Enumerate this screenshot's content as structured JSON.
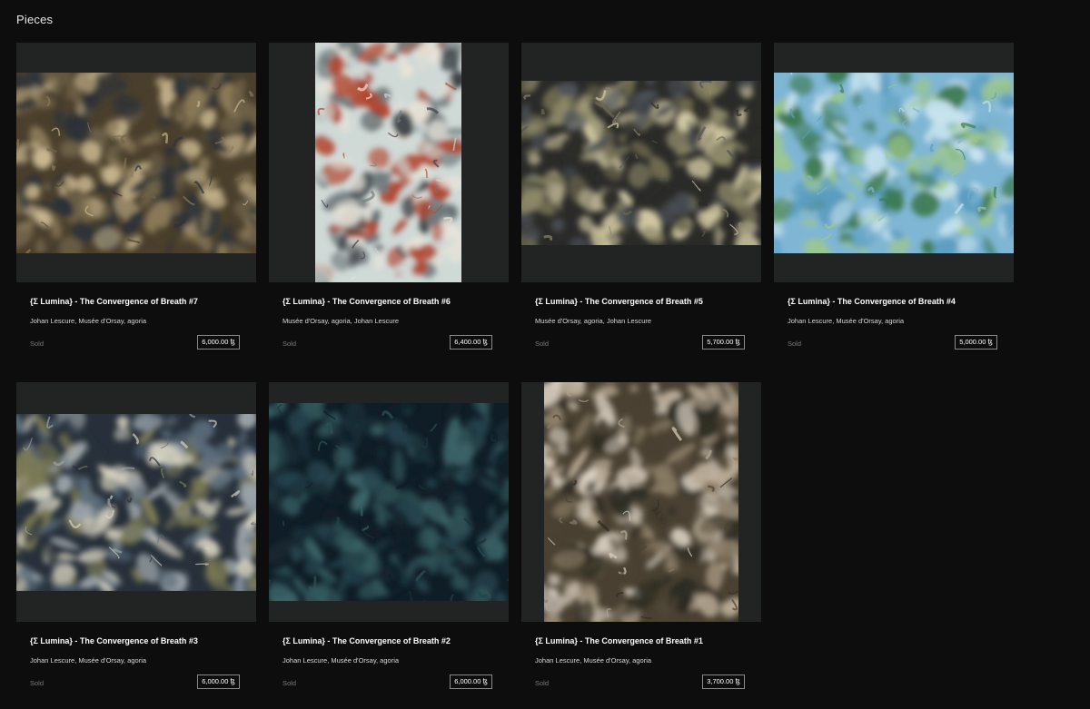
{
  "section": {
    "title": "Pieces"
  },
  "pieces": [
    {
      "title": "{Σ Lumina} - The Convergence of Breath #7",
      "artists": "Johan Lescure, Musée d'Orsay, agoria",
      "status": "Sold",
      "price": "6,000.00 ꜩ",
      "palette": [
        "#4a3f2c",
        "#8a7a58",
        "#c9b78f",
        "#2b3138",
        "#6e6248"
      ]
    },
    {
      "title": "{Σ Lumina} - The Convergence of Breath #6",
      "artists": "Musée d'Orsay, agoria, Johan Lescure",
      "status": "Sold",
      "price": "6,400.00 ꜩ",
      "palette": [
        "#cfd9d6",
        "#3a3f45",
        "#b2462f",
        "#6f7a7c",
        "#e8e4da"
      ]
    },
    {
      "title": "{Σ Lumina} - The Convergence of Breath #5",
      "artists": "Musée d'Orsay, agoria, Johan Lescure",
      "status": "Sold",
      "price": "5,700.00 ꜩ",
      "palette": [
        "#2a2a28",
        "#8c8868",
        "#d4cba4",
        "#4b5158",
        "#6e6a50"
      ]
    },
    {
      "title": "{Σ Lumina} - The Convergence of Breath #4",
      "artists": "Johan Lescure, Musée d'Orsay, agoria",
      "status": "Sold",
      "price": "5,000.00 ꜩ",
      "palette": [
        "#7fb6d4",
        "#3d7a52",
        "#c8e4ef",
        "#5a9cc0",
        "#9fc98a"
      ]
    },
    {
      "title": "{Σ Lumina} - The Convergence of Breath #3",
      "artists": "Johan Lescure, Musée d'Orsay, agoria",
      "status": "Sold",
      "price": "6,000.00 ꜩ",
      "palette": [
        "#27303a",
        "#9aa3a8",
        "#d6d2c0",
        "#5c6e7e",
        "#7b7a55"
      ]
    },
    {
      "title": "{Σ Lumina} - The Convergence of Breath #2",
      "artists": "Johan Lescure, Musée d'Orsay, agoria",
      "status": "Sold",
      "price": "6,000.00 ꜩ",
      "palette": [
        "#0f1d26",
        "#24424c",
        "#3b6468",
        "#1a2e37",
        "#2f5358"
      ]
    },
    {
      "title": "{Σ Lumina} - The Convergence of Breath #1",
      "artists": "Johan Lescure, Musée d'Orsay, agoria",
      "status": "Sold",
      "price": "3,700.00 ꜩ",
      "palette": [
        "#4a4132",
        "#ddd3c4",
        "#8a7d66",
        "#2b2a22",
        "#b7a994"
      ]
    }
  ]
}
